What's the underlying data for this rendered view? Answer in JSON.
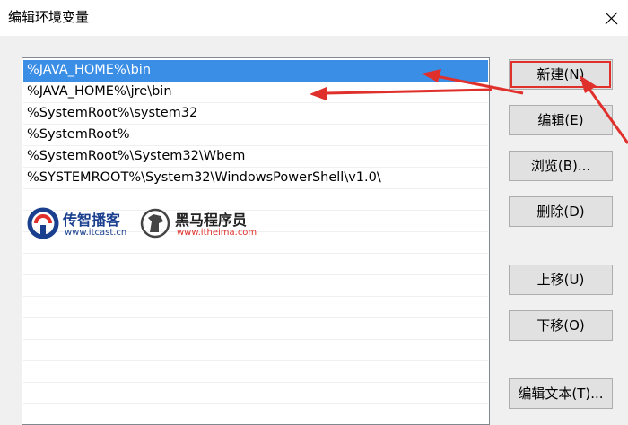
{
  "dialog": {
    "title": "编辑环境变量",
    "close_icon": "close-icon"
  },
  "path_list": {
    "items": [
      {
        "label": "%JAVA_HOME%\\bin",
        "selected": true
      },
      {
        "label": "%JAVA_HOME%\\jre\\bin",
        "selected": false
      },
      {
        "label": "%SystemRoot%\\system32",
        "selected": false
      },
      {
        "label": "%SystemRoot%",
        "selected": false
      },
      {
        "label": "%SystemRoot%\\System32\\Wbem",
        "selected": false
      },
      {
        "label": "%SYSTEMROOT%\\System32\\WindowsPowerShell\\v1.0\\",
        "selected": false
      }
    ],
    "selection_color": "#3a8ee6"
  },
  "buttons": {
    "new": "新建(N)",
    "edit": "编辑(E)",
    "browse": "浏览(B)...",
    "delete": "删除(D)",
    "move_up": "上移(U)",
    "move_down": "下移(O)",
    "edit_text": "编辑文本(T)..."
  },
  "watermark": {
    "logo1_name": "传智播客",
    "logo1_url": "www.itcast.cn",
    "logo2_name": "黑马程序员",
    "logo2_url": "www.itheima.com"
  },
  "annotation_color": "#e0302c"
}
